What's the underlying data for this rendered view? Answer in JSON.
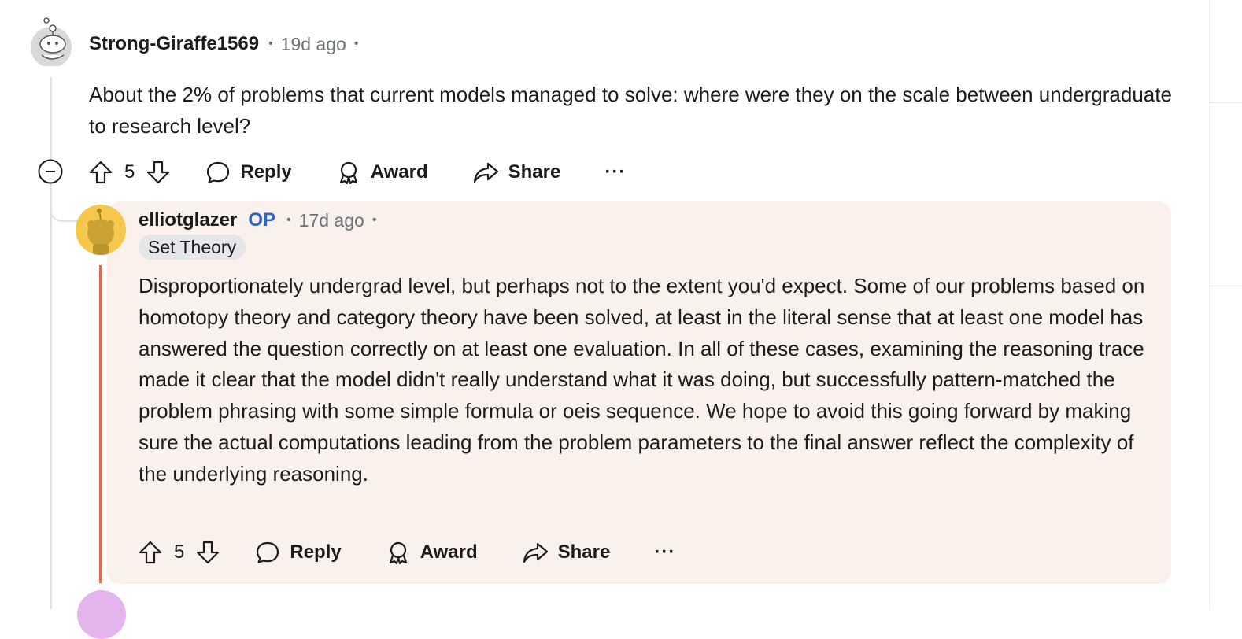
{
  "comment1": {
    "username": "Strong-Giraffe1569",
    "time": "19d ago",
    "body": "About the 2% of problems that current models managed to solve: where were they on the scale between undergraduate to research level?",
    "votes": "5",
    "actions": {
      "reply": "Reply",
      "award": "Award",
      "share": "Share",
      "more": "···"
    }
  },
  "comment2": {
    "username": "elliotglazer",
    "op_badge": "OP",
    "time": "17d ago",
    "flair": "Set Theory",
    "body": "Disproportionately undergrad level, but perhaps not to the extent you'd expect. Some of our problems based on homotopy theory and category theory have been solved, at least in the literal sense that at least one model has answered the question correctly on at least one evaluation. In all of these cases, examining the reasoning trace made it clear that the model didn't really understand what it was doing, but successfully pattern-matched the problem phrasing with some simple formula or oeis sequence. We hope to avoid this going forward by making sure the actual computations leading from the problem parameters to the final answer reflect the complexity of the underlying reasoning.",
    "votes": "5",
    "actions": {
      "reply": "Reply",
      "award": "Award",
      "share": "Share",
      "more": "···"
    }
  },
  "separator_dot": "•",
  "colors": {
    "op": "#2f65c4",
    "reply_bg": "#faf0ec",
    "thread_accent": "#ec6545",
    "avatar_yellow": "#f5c74a",
    "avatar_purple": "#e3b5ec"
  }
}
